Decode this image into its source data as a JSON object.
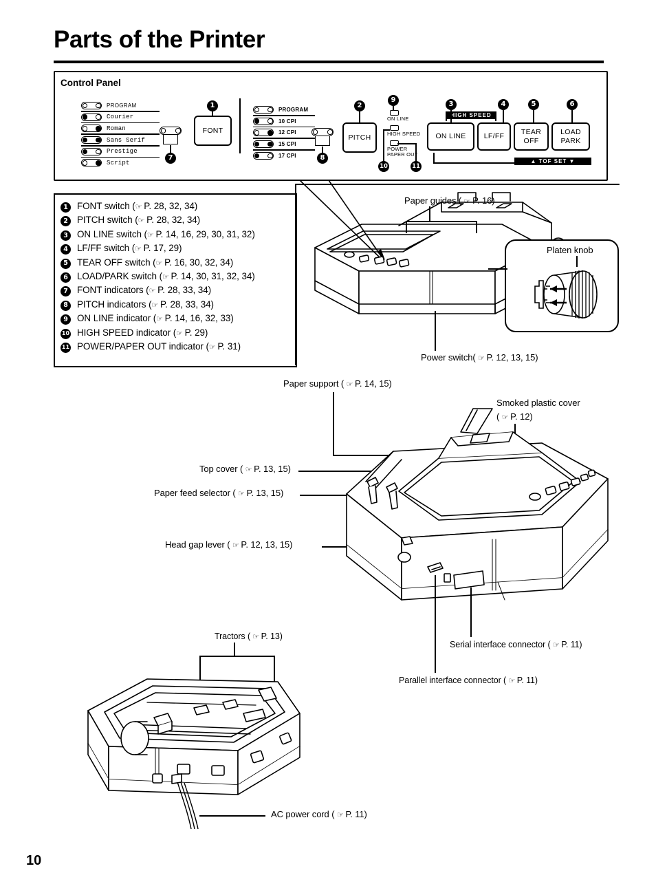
{
  "page": {
    "title": "Parts of the Printer",
    "number": "10"
  },
  "control_panel": {
    "heading": "Control Panel",
    "font_indicators": [
      {
        "label": "PROGRAM",
        "leds": [
          false,
          false
        ]
      },
      {
        "label": "Courier",
        "leds": [
          true,
          false
        ]
      },
      {
        "label": "Roman",
        "leds": [
          false,
          true
        ]
      },
      {
        "label": "Sans Serif",
        "leds": [
          true,
          true
        ]
      },
      {
        "label": "Prestige",
        "leds": [
          true,
          false
        ]
      },
      {
        "label": "Script",
        "leds": [
          false,
          true
        ]
      }
    ],
    "pitch_indicators": [
      {
        "label": "PROGRAM",
        "leds": [
          false,
          false
        ]
      },
      {
        "label": "10 CPI",
        "leds": [
          true,
          false
        ]
      },
      {
        "label": "12 CPI",
        "leds": [
          false,
          true
        ]
      },
      {
        "label": "15 CPI",
        "leds": [
          true,
          true
        ]
      },
      {
        "label": "17 CPI",
        "leds": [
          true,
          false
        ]
      }
    ],
    "buttons": {
      "font": "FONT",
      "pitch": "PITCH",
      "online": "ON LINE",
      "lfff": "LF/FF",
      "tearoff_line1": "TEAR",
      "tearoff_line2": "OFF",
      "loadpark_line1": "LOAD",
      "loadpark_line2": "PARK"
    },
    "status_leds": [
      {
        "label": "ON LINE",
        "on": false
      },
      {
        "label": "HIGH SPEED",
        "on": false
      },
      {
        "label": "POWER",
        "label2": "PAPER OUT",
        "on": false
      }
    ],
    "bars": {
      "high_speed": "HIGH SPEED",
      "tof_set": "▲  TOF  SET  ▼"
    },
    "callout_numbers": {
      "n1": "1",
      "n2": "2",
      "n3": "3",
      "n4": "4",
      "n5": "5",
      "n6": "6",
      "n7": "7",
      "n8": "8",
      "n9": "9",
      "n10": "10",
      "n11": "11"
    }
  },
  "legend": [
    {
      "num": "1",
      "text": "FONT switch (",
      "refs": "P. 28, 32, 34)"
    },
    {
      "num": "2",
      "text": "PITCH switch (",
      "refs": "P. 28, 32, 34)"
    },
    {
      "num": "3",
      "text": "ON LINE switch (",
      "refs": "P. 14, 16, 29, 30, 31, 32)"
    },
    {
      "num": "4",
      "text": "LF/FF switch (",
      "refs": "P. 17, 29)"
    },
    {
      "num": "5",
      "text": "TEAR OFF switch (",
      "refs": "P. 16, 30, 32, 34)"
    },
    {
      "num": "6",
      "text": "LOAD/PARK switch (",
      "refs": "P. 14, 30, 31, 32, 34)"
    },
    {
      "num": "7",
      "text": "FONT indicators (",
      "refs": "P. 28, 33, 34)"
    },
    {
      "num": "8",
      "text": "PITCH indicators (",
      "refs": "P. 28, 33, 34)"
    },
    {
      "num": "9",
      "text": "ON LINE indicator (",
      "refs": "P. 14, 16, 32, 33)"
    },
    {
      "num": "10",
      "text": "HIGH SPEED indicator (",
      "refs": "P. 29)"
    },
    {
      "num": "11",
      "text": "POWER/PAPER OUT indicator (",
      "refs": "P. 31)"
    }
  ],
  "diagram_labels": {
    "paper_guides": "Paper guides (",
    "paper_guides_ref": "P. 16)",
    "platen_knob": "Platen knob",
    "power_switch": "Power switch(",
    "power_switch_ref": "P. 12, 13, 15)",
    "paper_support": "Paper support (",
    "paper_support_ref": "P. 14, 15)",
    "smoked_cover_line1": "Smoked plastic cover",
    "smoked_cover_line2": "(",
    "smoked_cover_ref": "P. 12)",
    "top_cover": "Top cover (",
    "top_cover_ref": "P. 13, 15)",
    "paper_feed_selector": "Paper feed selector (",
    "paper_feed_selector_ref": "P. 13, 15)",
    "head_gap_lever": "Head gap lever (",
    "head_gap_lever_ref": "P. 12, 13, 15)",
    "tractors": "Tractors (",
    "tractors_ref": "P. 13)",
    "serial_connector": "Serial interface connector (",
    "serial_connector_ref": "P. 11)",
    "parallel_connector": "Parallel interface connector (",
    "parallel_connector_ref": "P. 11)",
    "ac_power_cord": "AC power cord (",
    "ac_power_cord_ref": "P. 11)"
  },
  "icons": {
    "pointing_hand": "☞"
  }
}
